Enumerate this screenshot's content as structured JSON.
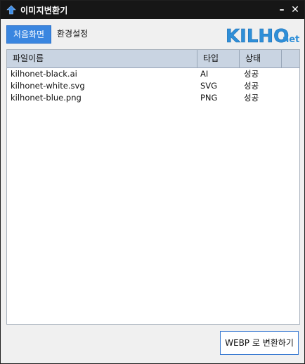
{
  "window": {
    "title": "이미지변환기",
    "minimize_label": "–",
    "close_label": "✕"
  },
  "icons": {
    "app": "app-upload-icon",
    "minimize": "minimize-icon",
    "close": "close-icon"
  },
  "toolbar": {
    "home_tab": "처음화면",
    "settings_tab": "환경설정"
  },
  "logo": {
    "main": "KILHO",
    "suffix": ".net"
  },
  "table": {
    "columns": [
      "파일이름",
      "타입",
      "상태",
      ""
    ],
    "rows": [
      {
        "name": "kilhonet-black.ai",
        "type": "AI",
        "status": "성공"
      },
      {
        "name": "kilhonet-white.svg",
        "type": "SVG",
        "status": "성공"
      },
      {
        "name": "kilhonet-blue.png",
        "type": "PNG",
        "status": "성공"
      }
    ]
  },
  "actions": {
    "convert_label": "WEBP 로 변환하기"
  },
  "colors": {
    "accent": "#3a86e0",
    "titlebar": "#161616",
    "header": "#c9d4e2",
    "logo_blue": "#2f8fd8"
  }
}
